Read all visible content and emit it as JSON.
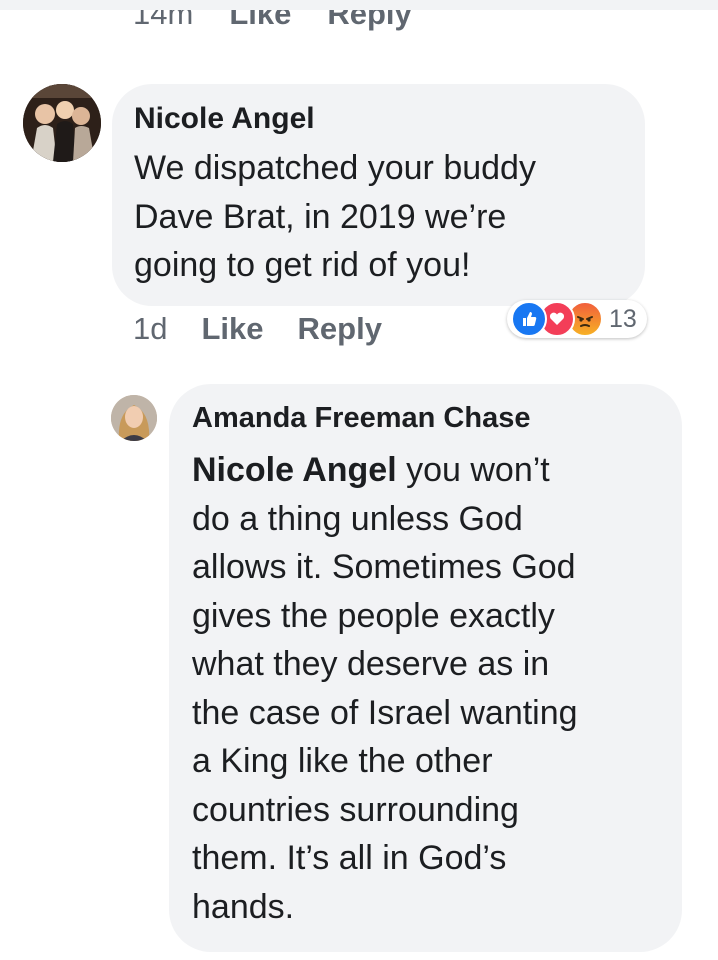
{
  "previous_comment": {
    "timestamp": "14m",
    "like_label": "Like",
    "reply_label": "Reply"
  },
  "comment1": {
    "author": "Nicole Angel",
    "lines": [
      "We dispatched your buddy",
      "Dave Brat, in 2019 we’re",
      "going to get rid of you!"
    ],
    "timestamp": "1d",
    "like_label": "Like",
    "reply_label": "Reply",
    "reactions": {
      "icons": [
        "like-icon",
        "love-icon",
        "angry-icon"
      ],
      "count": "13"
    }
  },
  "reply1": {
    "author": "Amanda Freeman Chase",
    "mention": "Nicole Angel",
    "lines": [
      " you won’t",
      "do a thing unless God",
      "allows it.  Sometimes God",
      "gives the people exactly",
      "what they deserve as in",
      "the case of Israel wanting",
      "a King like the other",
      "countries surrounding",
      "them.  It’s all in God’s",
      "hands."
    ]
  },
  "colors": {
    "bubble": "#f2f3f5",
    "secondary_text": "#606770",
    "like_blue": "#1877f2",
    "love_red": "#f33e58"
  }
}
